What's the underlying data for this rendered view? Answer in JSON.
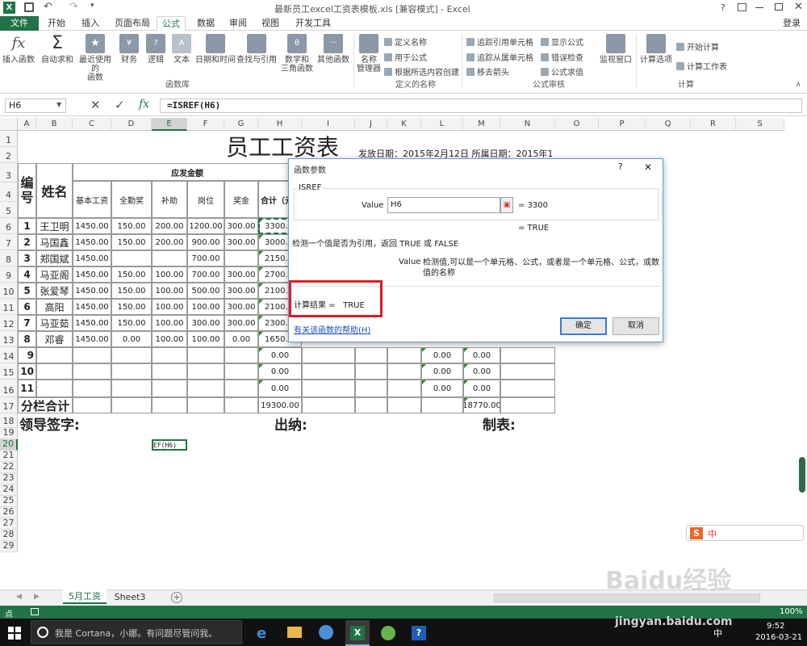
{
  "titlebar": {
    "title": "最新员工excel工资表模板.xls [兼容模式] - Excel",
    "help": "?",
    "user": "登录"
  },
  "tabs": [
    "文件",
    "开始",
    "插入",
    "页面布局",
    "公式",
    "数据",
    "审阅",
    "视图",
    "开发工具"
  ],
  "ribbon": {
    "insert_function": "插入函数",
    "autosum": "自动求和",
    "recent": "最近使用的\n函数",
    "financial": "财务",
    "logical": "逻辑",
    "text": "文本",
    "datetime": "日期和时间",
    "lookup": "查找与引用",
    "math": "数学和\n三角函数",
    "more": "其他函数",
    "group_library": "函数库",
    "name_manager": "名称\n管理器",
    "define_name": "定义名称",
    "use_in_formula": "用于公式",
    "create_from_selection": "根据所选内容创建",
    "group_names": "定义的名称",
    "trace_precedents": "追踪引用单元格",
    "trace_dependents": "追踪从属单元格",
    "remove_arrows": "移去箭头",
    "show_formulas": "显示公式",
    "error_checking": "错误检查",
    "evaluate_formula": "公式求值",
    "watch_window": "监视窗口",
    "group_audit": "公式审核",
    "calc_options": "计算选项",
    "calc_now": "开始计算",
    "calc_sheet": "计算工作表",
    "group_calc": "计算"
  },
  "formula_bar": {
    "name_box": "H6",
    "formula": "=ISREF(H6)",
    "fx": "fx"
  },
  "columns": [
    "A",
    "B",
    "C",
    "D",
    "E",
    "F",
    "G",
    "H",
    "I",
    "J",
    "K",
    "L",
    "M",
    "N",
    "O",
    "P",
    "Q",
    "R",
    "S"
  ],
  "rows": [
    "1",
    "2",
    "3",
    "4",
    "5",
    "6",
    "7",
    "8",
    "9",
    "10",
    "11",
    "12",
    "13",
    "14",
    "15",
    "16",
    "17",
    "18",
    "19",
    "20",
    "21",
    "22",
    "23",
    "24",
    "25",
    "26",
    "27",
    "28",
    "29"
  ],
  "sheet": {
    "title": "员工工资表",
    "date_line": "发放日期：2015年2月12日 所属日期：2015年1月",
    "header_no": "编\n号",
    "header_name": "姓名",
    "header_pay": "应发金额",
    "sub_headers": [
      "基本工资",
      "全勤奖",
      "补助",
      "岗位",
      "奖金",
      "合计（元"
    ],
    "data_rows": [
      {
        "no": "1",
        "name": "王卫明",
        "basic": "1450.00",
        "att": "150.00",
        "sub": "200.00",
        "post": "1200.00",
        "bonus": "300.00",
        "total": "3300.00"
      },
      {
        "no": "2",
        "name": "马国鑫",
        "basic": "1450.00",
        "att": "150.00",
        "sub": "200.00",
        "post": "900.00",
        "bonus": "300.00",
        "total": "3000.00"
      },
      {
        "no": "3",
        "name": "郑国斌",
        "basic": "1450.00",
        "att": "",
        "sub": "",
        "post": "700.00",
        "bonus": "",
        "total": "2150.0"
      },
      {
        "no": "4",
        "name": "马亚阁",
        "basic": "1450.00",
        "att": "150.00",
        "sub": "100.00",
        "post": "700.00",
        "bonus": "300.00",
        "total": "2700.0"
      },
      {
        "no": "5",
        "name": "张爱琴",
        "basic": "1450.00",
        "att": "150.00",
        "sub": "100.00",
        "post": "500.00",
        "bonus": "300.00",
        "total": "2100.0"
      },
      {
        "no": "6",
        "name": "高阳",
        "basic": "1450.00",
        "att": "150.00",
        "sub": "100.00",
        "post": "100.00",
        "bonus": "300.00",
        "total": "2100.0"
      },
      {
        "no": "7",
        "name": "马亚茹",
        "basic": "1450.00",
        "att": "150.00",
        "sub": "100.00",
        "post": "300.00",
        "bonus": "300.00",
        "total": "2300.0"
      },
      {
        "no": "8",
        "name": "邓睿",
        "basic": "1450.00",
        "att": "0.00",
        "sub": "100.00",
        "post": "100.00",
        "bonus": "0.00",
        "total": "1650.0"
      }
    ],
    "empty_rows": [
      {
        "no": "9",
        "h": "0.00",
        "l": "0.00",
        "m": "0.00"
      },
      {
        "no": "10",
        "h": "0.00",
        "l": "0.00",
        "m": "0.00"
      },
      {
        "no": "11",
        "h": "0.00",
        "l": "0.00",
        "m": "0.00"
      }
    ],
    "subtotal_label": "分栏合计",
    "subtotal_h": "19300.00",
    "subtotal_m": "18770.00",
    "sign_leader": "领导签字:",
    "sign_cashier": "出纳:",
    "sign_maker": "制表:",
    "e20_text": "EF(H6)"
  },
  "dialog": {
    "title": "函数参数",
    "help": "?",
    "close": "✕",
    "func_name": "ISREF",
    "arg_label": "Value",
    "arg_value": "H6",
    "arg_result": "= 3300",
    "func_result": "= TRUE",
    "description": "检测一个值是否为引用，返回 TRUE 或 FALSE",
    "arg_desc_label": "Value",
    "arg_desc": "检测值,可以是一个单元格、公式，或者是一个单元格、公式，或数值的名称",
    "calc_result": "计算结果 =   TRUE",
    "help_link": "有关该函数的帮助(H)",
    "ok": "确定",
    "cancel": "取消"
  },
  "sheet_tabs": [
    "5月工资",
    "Sheet3"
  ],
  "status": {
    "mode": "点",
    "zoom": "100%"
  },
  "taskbar": {
    "cortana": "我是 Cortana，小娜。有问题尽管问我。",
    "time": "9:52",
    "date": "2016-03-21",
    "ime": "中"
  },
  "watermark": {
    "text": "Baidu经验",
    "url": "jingyan.baidu.com"
  }
}
